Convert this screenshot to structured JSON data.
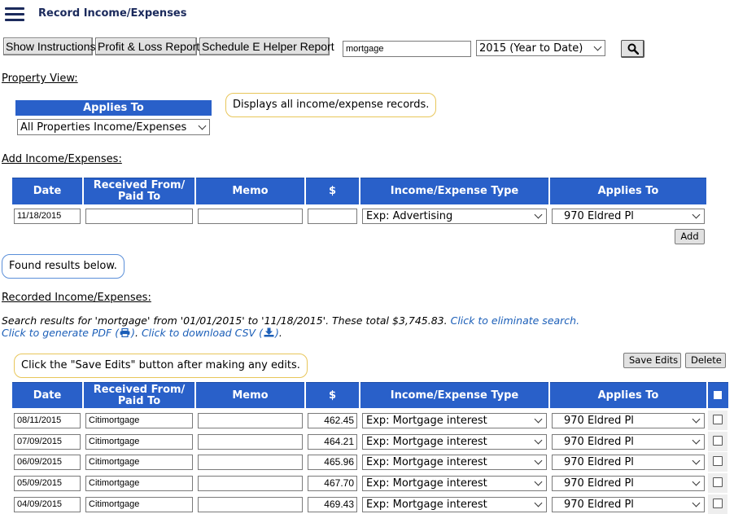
{
  "header": {
    "title": "Record Income/Expenses"
  },
  "toolbar": {
    "show_instructions": "Show Instructions",
    "profit_loss": "Profit & Loss Report",
    "schedule_e": "Schedule E Helper Report",
    "search_value": "mortgage",
    "period_value": "2015 (Year to Date)"
  },
  "property_view": {
    "label": "Property View:",
    "applies_to_header": "Applies To",
    "selected": "All Properties Income/Expenses",
    "callout": "Displays all income/expense records."
  },
  "add_section": {
    "label": "Add Income/Expenses:",
    "headers": {
      "date": "Date",
      "received_line1": "Received From/",
      "received_line2": "Paid To",
      "memo": "Memo",
      "amount": "$",
      "type": "Income/Expense Type",
      "applies": "Applies To"
    },
    "date_value": "11/18/2015",
    "type_value": "Exp: Advertising",
    "applies_value": "970 Eldred Pl",
    "add_button": "Add"
  },
  "found_callout": "Found results below.",
  "recorded": {
    "label": "Recorded Income/Expenses:",
    "summary": "Search results for 'mortgage' from '01/01/2015' to '11/18/2015'. These total $3,745.83.",
    "eliminate_link": "Click to eliminate search.",
    "pdf_link": "Click to generate PDF (",
    "csv_link": "Click to download CSV (",
    "link_close": ")",
    "period": ".",
    "save_callout": "Click the \"Save Edits\" button after making any edits.",
    "save_button": "Save Edits",
    "delete_button": "Delete",
    "rows": [
      {
        "date": "08/11/2015",
        "payee": "Citimortgage",
        "memo": "",
        "amount": "462.45",
        "type": "Exp: Mortgage interest",
        "applies": "970 Eldred Pl"
      },
      {
        "date": "07/09/2015",
        "payee": "Citimortgage",
        "memo": "",
        "amount": "464.21",
        "type": "Exp: Mortgage interest",
        "applies": "970 Eldred Pl"
      },
      {
        "date": "06/09/2015",
        "payee": "Citimortgage",
        "memo": "",
        "amount": "465.96",
        "type": "Exp: Mortgage interest",
        "applies": "970 Eldred Pl"
      },
      {
        "date": "05/09/2015",
        "payee": "Citimortgage",
        "memo": "",
        "amount": "467.70",
        "type": "Exp: Mortgage interest",
        "applies": "970 Eldred Pl"
      },
      {
        "date": "04/09/2015",
        "payee": "Citimortgage",
        "memo": "",
        "amount": "469.43",
        "type": "Exp: Mortgage interest",
        "applies": "970 Eldred Pl"
      }
    ]
  },
  "colors": {
    "header_blue": "#2960c9",
    "title_navy": "#1b2a5c",
    "link_blue": "#1c5fb8",
    "callout_yellow": "#e8c65a",
    "callout_blue": "#5b8fd9"
  },
  "icons": {
    "menu": "hamburger-icon",
    "search": "search-icon",
    "pdf": "printer-icon",
    "csv": "download-icon"
  }
}
